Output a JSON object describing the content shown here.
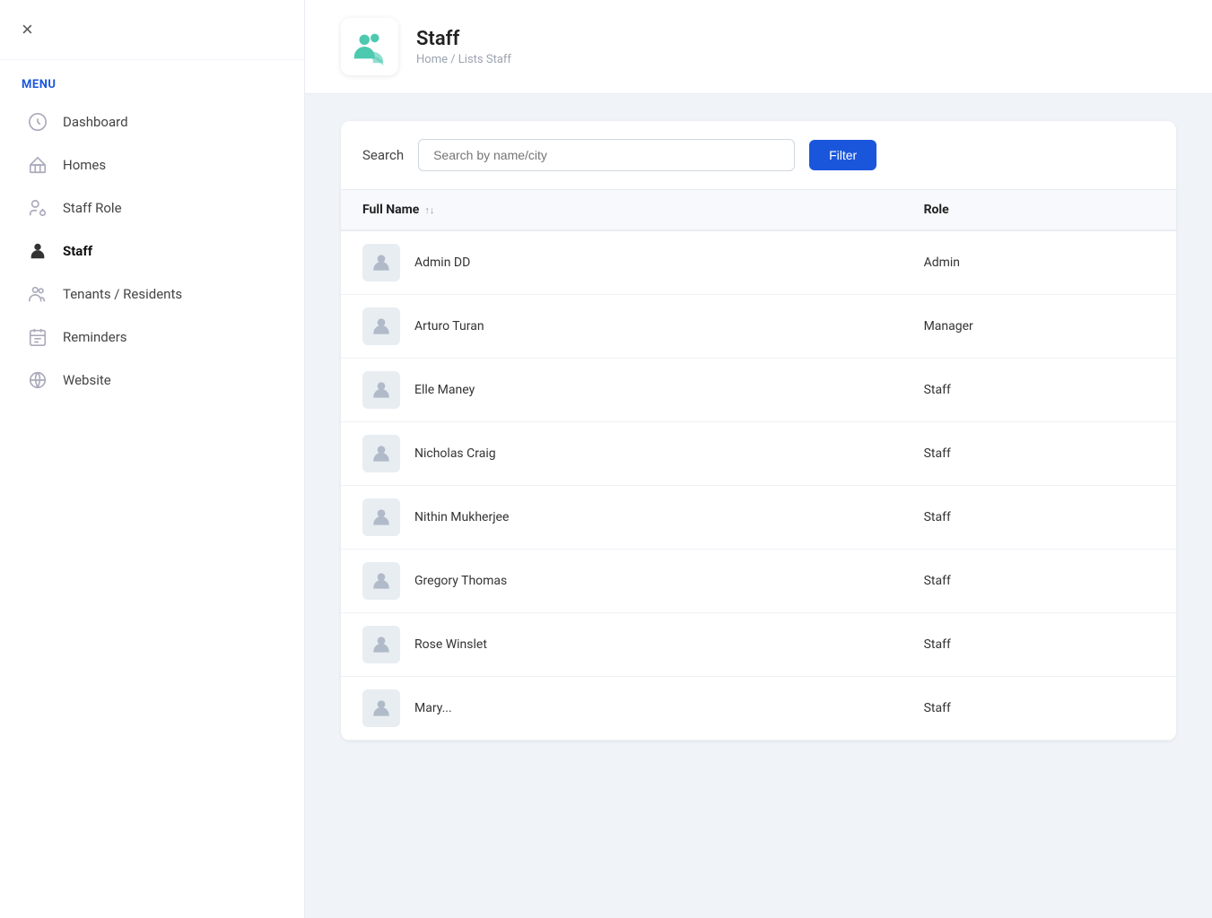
{
  "app": {
    "close_label": "×"
  },
  "sidebar": {
    "menu_label": "MENU",
    "items": [
      {
        "id": "dashboard",
        "label": "Dashboard",
        "icon": "dashboard-icon",
        "active": false
      },
      {
        "id": "homes",
        "label": "Homes",
        "icon": "homes-icon",
        "active": false
      },
      {
        "id": "staff-role",
        "label": "Staff Role",
        "icon": "staff-role-icon",
        "active": false
      },
      {
        "id": "staff",
        "label": "Staff",
        "icon": "staff-icon",
        "active": true
      },
      {
        "id": "tenants",
        "label": "Tenants / Residents",
        "icon": "tenants-icon",
        "active": false
      },
      {
        "id": "reminders",
        "label": "Reminders",
        "icon": "reminders-icon",
        "active": false
      },
      {
        "id": "website",
        "label": "Website",
        "icon": "website-icon",
        "active": false
      }
    ]
  },
  "page": {
    "title": "Staff",
    "breadcrumb": "Home / Lists Staff"
  },
  "search": {
    "label": "Search",
    "placeholder": "Search by name/city",
    "filter_button": "Filter"
  },
  "table": {
    "columns": [
      {
        "id": "full_name",
        "label": "Full Name"
      },
      {
        "id": "role",
        "label": "Role"
      }
    ],
    "rows": [
      {
        "id": 1,
        "full_name": "Admin DD",
        "role": "Admin"
      },
      {
        "id": 2,
        "full_name": "Arturo Turan",
        "role": "Manager"
      },
      {
        "id": 3,
        "full_name": "Elle Maney",
        "role": "Staff"
      },
      {
        "id": 4,
        "full_name": "Nicholas Craig",
        "role": "Staff"
      },
      {
        "id": 5,
        "full_name": "Nithin Mukherjee",
        "role": "Staff"
      },
      {
        "id": 6,
        "full_name": "Gregory Thomas",
        "role": "Staff"
      },
      {
        "id": 7,
        "full_name": "Rose Winslet",
        "role": "Staff"
      },
      {
        "id": 8,
        "full_name": "Mary...",
        "role": "Staff"
      }
    ]
  }
}
